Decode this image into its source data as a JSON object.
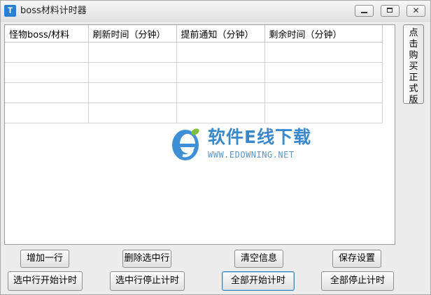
{
  "window": {
    "title": "boss材料计时器",
    "icon_letter": "T",
    "close_glyph": "✕"
  },
  "table": {
    "columns": [
      "怪物boss/材料",
      "刷新时间（分钟）",
      "提前通知（分钟）",
      "剩余时间（分钟）"
    ],
    "rows": [
      [
        "",
        "",
        "",
        ""
      ],
      [
        "",
        "",
        "",
        ""
      ],
      [
        "",
        "",
        "",
        ""
      ],
      [
        "",
        "",
        "",
        ""
      ]
    ]
  },
  "side_button": {
    "label": "点击购买正式版"
  },
  "watermark": {
    "title": "软件E线下载",
    "url": "WWW.EDOWNING.NET"
  },
  "buttons": {
    "add_row": "增加一行",
    "delete_selected": "删除选中行",
    "clear_info": "清空信息",
    "save_settings": "保存设置",
    "start_selected": "选中行开始计时",
    "stop_selected": "选中行停止计时",
    "start_all": "全部开始计时",
    "stop_all": "全部停止计时"
  },
  "colors": {
    "accent": "#3a88cc",
    "focus_border": "#3c7fb1"
  }
}
